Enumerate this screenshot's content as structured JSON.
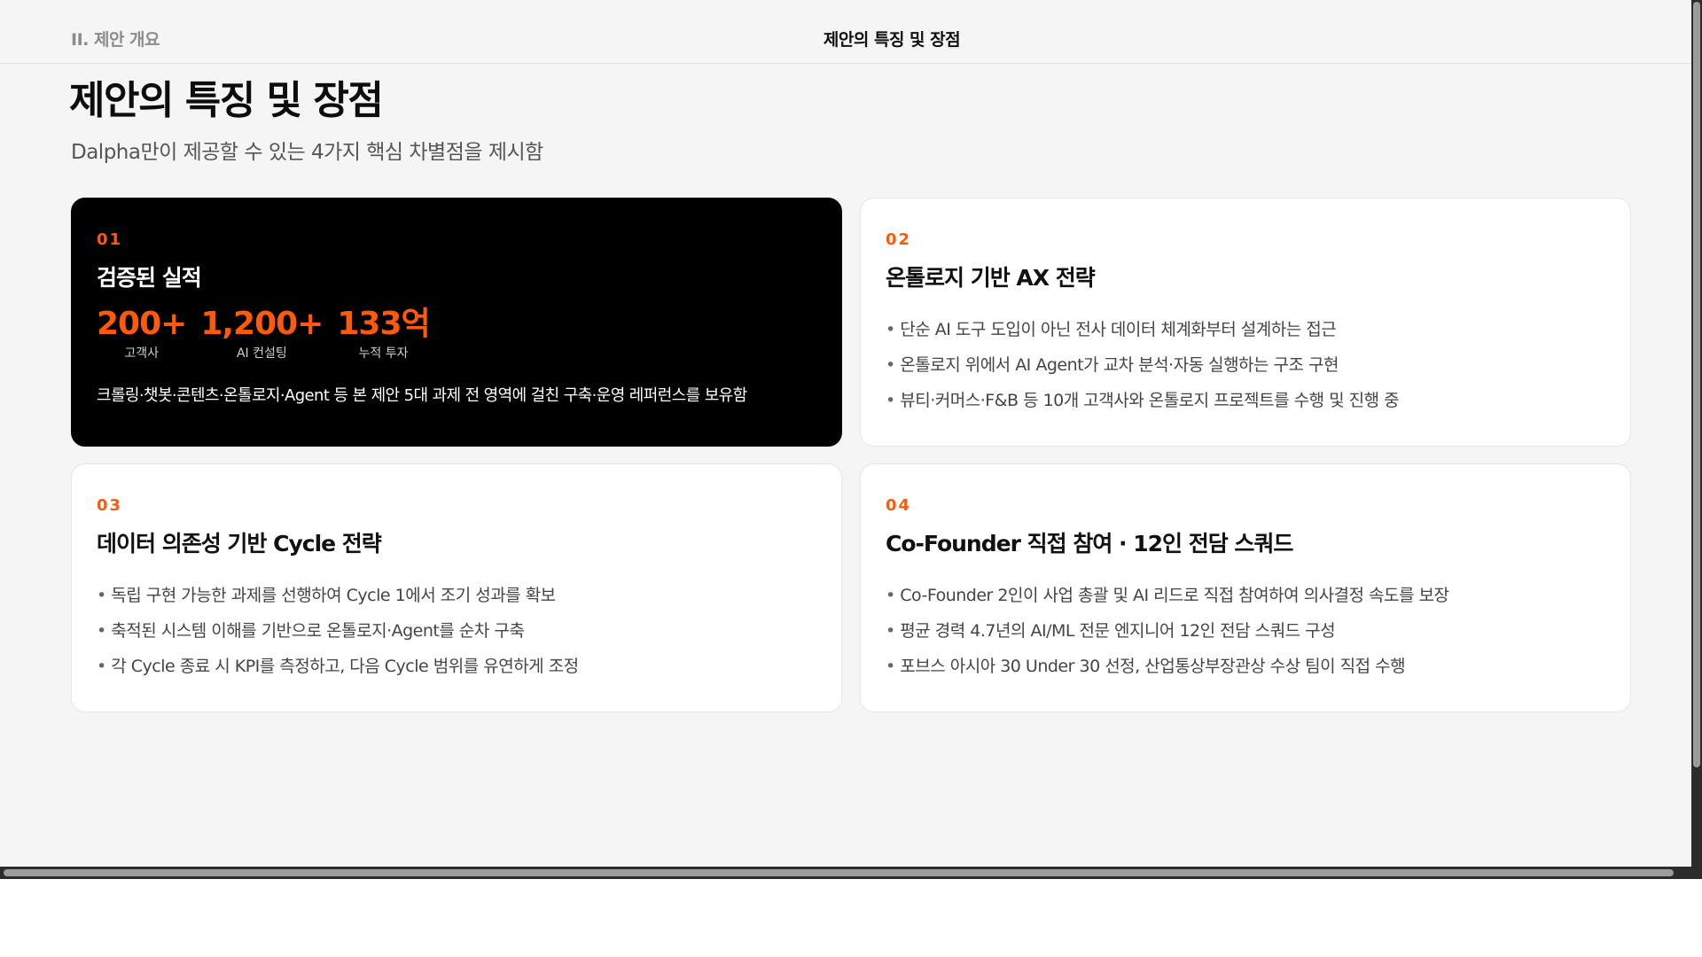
{
  "header": {
    "section_label": "II. 제안 개요",
    "title": "제안의 특징 및 장점"
  },
  "page": {
    "title": "제안의 특징 및 장점",
    "subtitle": "Dalpha만이 제공할 수 있는 4가지 핵심 차별점을 제시함"
  },
  "cards": [
    {
      "number": "01",
      "title": "검증된 실적",
      "stats": [
        {
          "value": "200+",
          "label": "고객사"
        },
        {
          "value": "1,200+",
          "label": "AI 컨설팅"
        },
        {
          "value": "133억",
          "label": "누적 투자"
        }
      ],
      "description": "크롤링·챗봇·콘텐츠·온톨로지·Agent 등 본 제안 5대 과제 전 영역에 걸친 구축·운영 레퍼런스를 보유함"
    },
    {
      "number": "02",
      "title": "온톨로지 기반 AX 전략",
      "bullets": [
        "단순 AI 도구 도입이 아닌 전사 데이터 체계화부터 설계하는 접근",
        "온톨로지 위에서 AI Agent가 교차 분석·자동 실행하는 구조 구현",
        "뷰티·커머스·F&B 등 10개 고객사와 온톨로지 프로젝트를 수행 및 진행 중"
      ]
    },
    {
      "number": "03",
      "title": "데이터 의존성 기반 Cycle 전략",
      "bullets": [
        "독립 구현 가능한 과제를 선행하여 Cycle 1에서 조기 성과를 확보",
        "축적된 시스템 이해를 기반으로 온톨로지·Agent를 순차 구축",
        "각 Cycle 종료 시 KPI를 측정하고, 다음 Cycle 범위를 유연하게 조정"
      ]
    },
    {
      "number": "04",
      "title": "Co-Founder 직접 참여 · 12인 전담 스쿼드",
      "bullets": [
        "Co-Founder 2인이 사업 총괄 및 AI 리드로 직접 참여하여 의사결정 속도를 보장",
        "평균 경력 4.7년의 AI/ML 전문 엔지니어 12인 전담 스쿼드 구성",
        "포브스 아시아 30 Under 30 선정, 산업통상부장관상 수상 팀이 직접 수행"
      ]
    }
  ],
  "colors": {
    "accent": "#ff5a0a",
    "background": "#f5f5f5",
    "dark_card": "#000000"
  }
}
